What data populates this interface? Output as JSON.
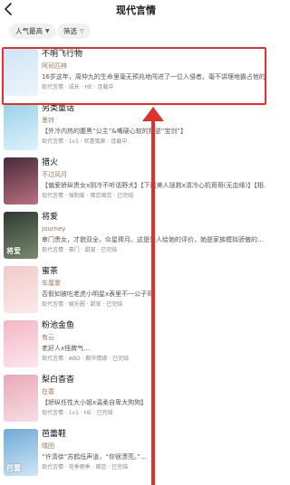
{
  "header": {
    "title": "现代言情",
    "back_icon": "back-chevron-icon"
  },
  "filters": {
    "sort_label": "人气最高",
    "filter_label": "筛选"
  },
  "books": [
    {
      "title": "不明飞行物",
      "author": "阿司匹林",
      "desc": "16岁这年，周仲九的生命里毫无预兆地闯进了一位入侵者。毫不讲理地霸占他的",
      "tags": "现代言情 · 成长 · HE · 连载中",
      "cover_colors": [
        "#cfe4f5",
        "#eef5fb"
      ],
      "cover_text": ""
    },
    {
      "title": "另类童话",
      "author": "墨铃",
      "desc": "【外冷内热的腹黑“公主”&嘴硬心软的叛逆“宝剑”】",
      "tags": "现代言情 · 1v1 · 欢喜冤家 · 连载中",
      "cover_colors": [
        "#9ad0e8",
        "#dff2fb"
      ],
      "cover_text": ""
    },
    {
      "title": "猎火",
      "author": "不过风月",
      "desc": "【偏爱娇纵贵女x阴冷不听话野犬】【下属美人拯救x清冷心机哥哥(无血缘)】【相…",
      "tags": "现代言情 · 强制爱 · 暗恋暗恋 · 已完结",
      "cover_colors": [
        "#4a2a3a",
        "#b87080"
      ],
      "cover_text": ""
    },
    {
      "title": "将爱",
      "author": "Journey",
      "desc": "审门贵女，才貌双全，众星捧月。这是外人给她的评价，她是家族模拟骄傲的…",
      "tags": "现代言情 · 豪门 · 甜宠 · 已完结",
      "cover_colors": [
        "#2e3a30",
        "#7a8a70"
      ],
      "cover_text": "将爱"
    },
    {
      "title": "蜜茶",
      "author": "车厘寨",
      "desc": "否假如被吃老虎小明星x表里不一公子哥",
      "tags": "现代言情 · 娱乐圈 · 甜宠 · 已完结",
      "cover_colors": [
        "#f3c9c9",
        "#fbeaea"
      ],
      "cover_text": ""
    },
    {
      "title": "粉池金鱼",
      "author": "有云",
      "desc": "老好人x怪脾气…",
      "tags": "现代言情 · ABO · 都市情缘 · 已完结",
      "cover_colors": [
        "#f4b6c6",
        "#fde6ee"
      ],
      "cover_text": ""
    },
    {
      "title": "梨白杳杳",
      "author": "在蓑",
      "desc": "【娇纵任性大小姐x温柔自卑大狗狗】",
      "tags": "现代言情 · 1v1 · HE · 已完结",
      "cover_colors": [
        "#e8a8b8",
        "#f8dde4"
      ],
      "cover_text": ""
    },
    {
      "title": "芭蕾鞋",
      "author": "晴团",
      "desc": "“许清徐”苏鹤低声道，“你很漂亮。”…",
      "tags": "现代言情 · 花季雨季 · 暗恋 · 已完结",
      "cover_colors": [
        "#6fa9d6",
        "#cfe6f7"
      ],
      "cover_text": "芭蕾"
    }
  ]
}
